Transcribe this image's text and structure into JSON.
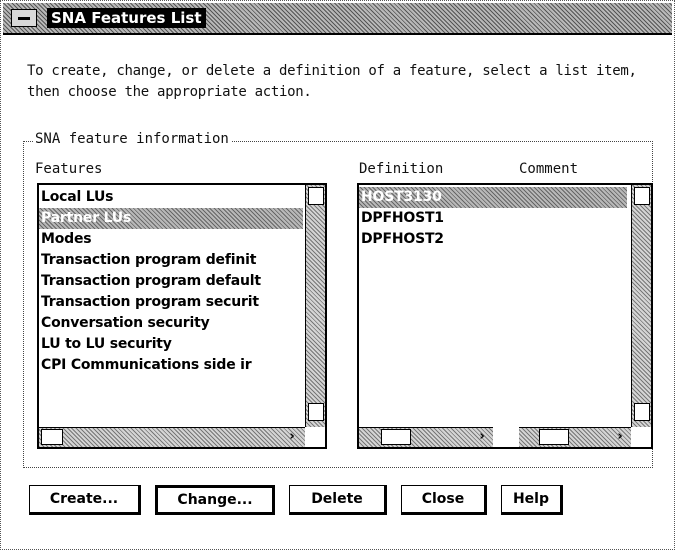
{
  "window": {
    "title": "SNA Features List",
    "description": "To create, change, or delete a definition of a feature, select a list item, then choose the appropriate action."
  },
  "group": {
    "legend": "SNA feature information",
    "features_label": "Features",
    "definition_label": "Definition",
    "comment_label": "Comment"
  },
  "features": [
    {
      "label": "Local LUs",
      "selected": false
    },
    {
      "label": "Partner LUs",
      "selected": true
    },
    {
      "label": "Modes",
      "selected": false
    },
    {
      "label": "Transaction program definit",
      "selected": false
    },
    {
      "label": "Transaction program default",
      "selected": false
    },
    {
      "label": "Transaction program securit",
      "selected": false
    },
    {
      "label": "Conversation security",
      "selected": false
    },
    {
      "label": "LU to LU security",
      "selected": false
    },
    {
      "label": "CPI Communications side ir",
      "selected": false
    }
  ],
  "definitions": [
    {
      "label": "HOST3130",
      "selected": true
    },
    {
      "label": "DPFHOST1",
      "selected": false
    },
    {
      "label": "DPFHOST2",
      "selected": false
    }
  ],
  "buttons": {
    "create": "Create...",
    "change": "Change...",
    "delete": "Delete",
    "close": "Close",
    "help": "Help"
  },
  "icons": {
    "system_menu": "system-menu-icon",
    "scroll_right": "arrow-right-icon"
  }
}
